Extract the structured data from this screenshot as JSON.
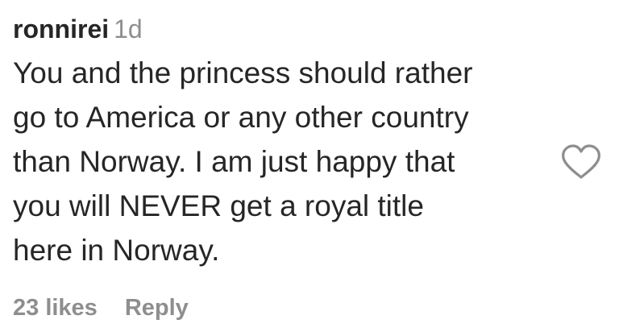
{
  "comment": {
    "username": "ronnirei",
    "time": "1d",
    "text_lines": [
      "You and the princess should rather",
      "go to America or any other country",
      "than Norway. I am just happy that",
      "you will NEVER get a royal title",
      "here in Norway."
    ],
    "likes": "23 likes",
    "reply_label": "Reply",
    "like_icon": "heart-outline-icon"
  }
}
